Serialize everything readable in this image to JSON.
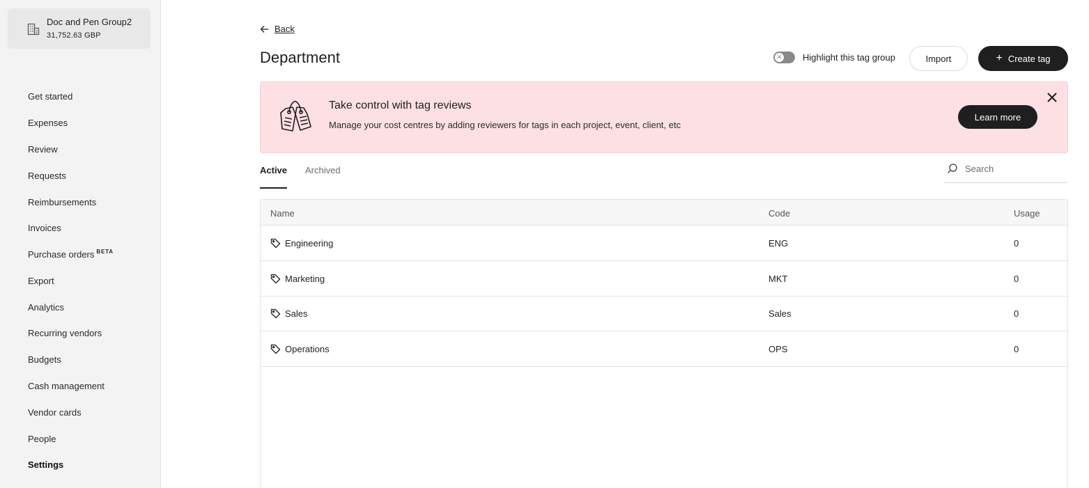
{
  "company": {
    "name": "Doc and Pen Group2",
    "balance": "31,752.63 GBP"
  },
  "nav": {
    "items": [
      {
        "label": "Get started"
      },
      {
        "label": "Expenses"
      },
      {
        "label": "Review"
      },
      {
        "label": "Requests"
      },
      {
        "label": "Reimbursements"
      },
      {
        "label": "Invoices"
      },
      {
        "label": "Purchase orders",
        "badge": "BETA"
      },
      {
        "label": "Export"
      },
      {
        "label": "Analytics"
      },
      {
        "label": "Recurring vendors"
      },
      {
        "label": "Budgets"
      },
      {
        "label": "Cash management"
      },
      {
        "label": "Vendor cards"
      },
      {
        "label": "People"
      },
      {
        "label": "Settings",
        "active": true
      }
    ]
  },
  "header": {
    "back_label": "Back",
    "title": "Department",
    "toggle_label": "Highlight this tag group",
    "toggle_on": false,
    "import_label": "Import",
    "create_label": "Create tag"
  },
  "banner": {
    "title": "Take control with tag reviews",
    "description": "Manage your cost centres by adding reviewers for tags in each project, event, client, etc",
    "learn_more_label": "Learn more",
    "background": "#fde0e4"
  },
  "tabs": [
    {
      "label": "Active",
      "active": true
    },
    {
      "label": "Archived",
      "active": false
    }
  ],
  "search": {
    "placeholder": "Search",
    "value": ""
  },
  "table": {
    "columns": {
      "name": "Name",
      "code": "Code",
      "usage": "Usage"
    },
    "rows": [
      {
        "name": "Engineering",
        "code": "ENG",
        "usage": "0"
      },
      {
        "name": "Marketing",
        "code": "MKT",
        "usage": "0"
      },
      {
        "name": "Sales",
        "code": "Sales",
        "usage": "0"
      },
      {
        "name": "Operations",
        "code": "OPS",
        "usage": "0"
      }
    ]
  },
  "colors": {
    "primary": "#1f1f1f",
    "sidebar": "#f3f3f3"
  }
}
